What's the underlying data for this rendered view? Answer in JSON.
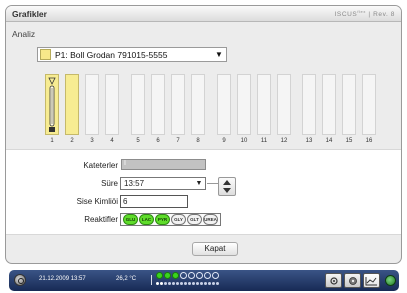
{
  "window": {
    "title": "Grafikler",
    "brand": "ISCUS",
    "brand_sup": "flex",
    "brand_suffix": "| Rev. 8"
  },
  "section": {
    "label": "Analiz"
  },
  "patient": {
    "selected": "P1: Boll Grodan 791015-5555",
    "swatch_color": "#f7e98a"
  },
  "slots": {
    "numbers": [
      "1",
      "2",
      "3",
      "4",
      "5",
      "6",
      "7",
      "8",
      "9",
      "10",
      "11",
      "12",
      "13",
      "14",
      "15",
      "16"
    ],
    "active_slot": "1",
    "filled_slots": [
      "1",
      "2"
    ]
  },
  "form": {
    "katater_label": "Kateterler",
    "katater_value": "I",
    "sure_label": "Süre",
    "sure_value": "13:57",
    "kimlik_label": "Sise Kimliöi",
    "kimlik_value": "6",
    "reagents_label": "Reaktifler",
    "reagents": [
      {
        "name": "GLU",
        "active": true
      },
      {
        "name": "LAC",
        "active": true
      },
      {
        "name": "PYR",
        "active": true
      },
      {
        "name": "GLY",
        "active": false
      },
      {
        "name": "GLT",
        "active": false
      },
      {
        "name": "UREA",
        "active": false
      }
    ]
  },
  "buttons": {
    "close_label": "Kapat"
  },
  "taskbar": {
    "datetime": "21.12.2009 13:57",
    "temperature": "26,2 °C",
    "status_dots_on": 3,
    "status_dots_total": 8
  },
  "colors": {
    "accent_yellow": "#f7e98a",
    "reagent_active": "#5fdc2a",
    "taskbar": "#1f3565"
  }
}
